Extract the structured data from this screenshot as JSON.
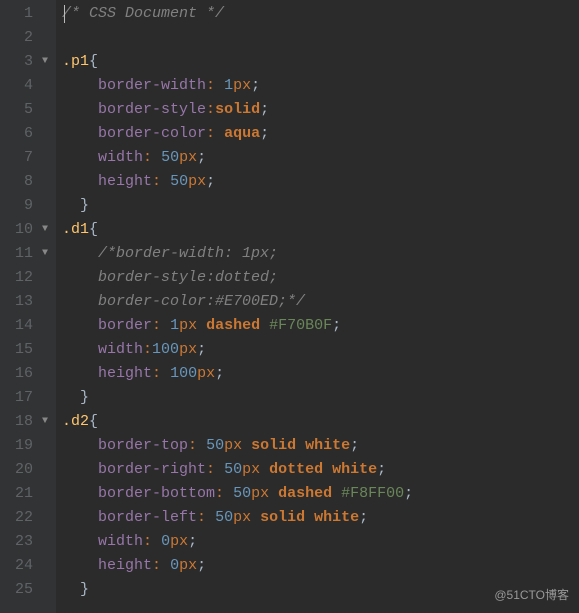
{
  "watermark": "@51CTO博客",
  "gutter": [
    {
      "n": "1",
      "fold": ""
    },
    {
      "n": "2",
      "fold": ""
    },
    {
      "n": "3",
      "fold": "▼"
    },
    {
      "n": "4",
      "fold": ""
    },
    {
      "n": "5",
      "fold": ""
    },
    {
      "n": "6",
      "fold": ""
    },
    {
      "n": "7",
      "fold": ""
    },
    {
      "n": "8",
      "fold": ""
    },
    {
      "n": "9",
      "fold": ""
    },
    {
      "n": "10",
      "fold": "▼"
    },
    {
      "n": "11",
      "fold": "▼"
    },
    {
      "n": "12",
      "fold": ""
    },
    {
      "n": "13",
      "fold": ""
    },
    {
      "n": "14",
      "fold": ""
    },
    {
      "n": "15",
      "fold": ""
    },
    {
      "n": "16",
      "fold": ""
    },
    {
      "n": "17",
      "fold": ""
    },
    {
      "n": "18",
      "fold": "▼"
    },
    {
      "n": "19",
      "fold": ""
    },
    {
      "n": "20",
      "fold": ""
    },
    {
      "n": "21",
      "fold": ""
    },
    {
      "n": "22",
      "fold": ""
    },
    {
      "n": "23",
      "fold": ""
    },
    {
      "n": "24",
      "fold": ""
    },
    {
      "n": "25",
      "fold": ""
    }
  ],
  "lines": {
    "l1_comment": "/* CSS Document */",
    "l3_sel": ".p1",
    "l3_brace": "{",
    "l4_prop": "border-width",
    "l4_val": "1",
    "l4_unit": "px",
    "l5_prop": "border-style",
    "l5_val": "solid",
    "l6_prop": "border-color",
    "l6_val": "aqua",
    "l7_prop": "width",
    "l7_val": "50",
    "l7_unit": "px",
    "l8_prop": "height",
    "l8_val": "50",
    "l8_unit": "px",
    "l9_brace": "}",
    "l10_sel": ".d1",
    "l10_brace": "{",
    "l11_comment": "/*border-width: 1px;",
    "l12_comment": "border-style:dotted;",
    "l13_comment": "border-color:#E700ED;*/",
    "l14_prop": "border",
    "l14_v1": "1",
    "l14_u1": "px",
    "l14_v2": "dashed",
    "l14_hex": "#F70B0F",
    "l15_prop": "width",
    "l15_val": "100",
    "l15_unit": "px",
    "l16_prop": "height",
    "l16_val": "100",
    "l16_unit": "px",
    "l17_brace": "}",
    "l18_sel": ".d2",
    "l18_brace": "{",
    "l19_prop": "border-top",
    "l19_v1": "50",
    "l19_u1": "px",
    "l19_v2": "solid",
    "l19_v3": "white",
    "l20_prop": "border-right",
    "l20_v1": "50",
    "l20_u1": "px",
    "l20_v2": "dotted",
    "l20_v3": "white",
    "l21_prop": "border-bottom",
    "l21_v1": "50",
    "l21_u1": "px",
    "l21_v2": "dashed",
    "l21_hex": "#F8FF00",
    "l22_prop": "border-left",
    "l22_v1": "50",
    "l22_u1": "px",
    "l22_v2": "solid",
    "l22_v3": "white",
    "l23_prop": "width",
    "l23_val": "0",
    "l23_unit": "px",
    "l24_prop": "height",
    "l24_val": "0",
    "l24_unit": "px",
    "l25_brace": "}"
  }
}
